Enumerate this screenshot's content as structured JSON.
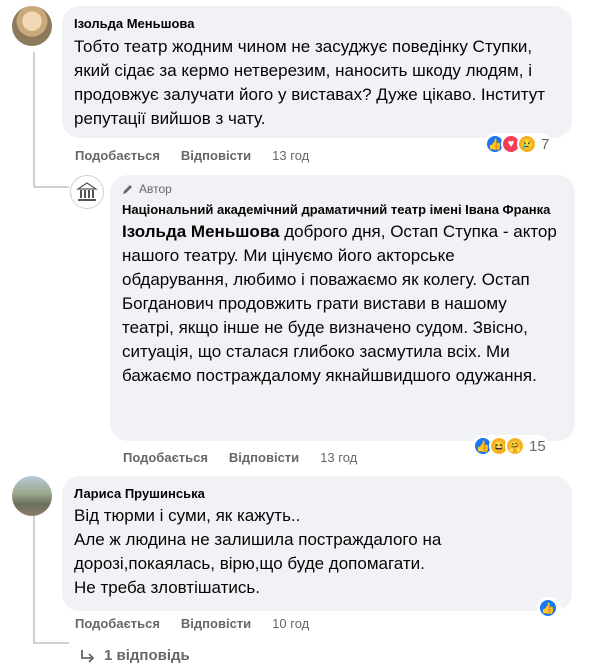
{
  "comments": [
    {
      "author": "Ізольда Меньшова",
      "text": "Тобто театр жодним чином не засуджує поведінку Ступки, який сідає за кермо нетверезим, наносить шкоду людям, і продовжує залучати його у виставах? Дуже цікаво. Інститут репутації вийшов з чату.",
      "like_label": "Подобається",
      "reply_label": "Відповісти",
      "time": "13 год",
      "reaction_count": "7",
      "reaction_icons": [
        "like-icon",
        "love-icon",
        "sad-icon"
      ]
    },
    {
      "badge": "Автор",
      "author": "Національний академічний драматичний театр імені Івана Франка",
      "mention": "Ізольда Меньшова",
      "text": " доброго дня, Остап Ступка - актор нашого театру. Ми цінуємо його акторське обдарування, любимо і поважаємо як колегу. Остап Богданович продовжить грати вистави в нашому театрі, якщо інше не буде визначено судом. Звісно, ситуація, що сталася глибоко засмутила всіх. Ми бажаємо постраждалому якнайшвидшого одужання.",
      "like_label": "Подобається",
      "reply_label": "Відповісти",
      "time": "13 год",
      "reaction_count": "15",
      "reaction_icons": [
        "like-icon",
        "haha-icon",
        "care-icon"
      ]
    },
    {
      "author": "Лариса Прушинська",
      "lines": [
        "Від тюрми і суми, як кажуть..",
        "Але ж людина не залишила постраждалого на дорозі,покаялась, вірю,що буде допомагати.",
        "Не треба зловтішатись."
      ],
      "like_label": "Подобається",
      "reply_label": "Відповісти",
      "time": "10 год",
      "reaction_icons": [
        "like-icon"
      ]
    }
  ],
  "replies_link": "1 відповідь",
  "colors": {
    "bubble": "#f0f2f5",
    "meta": "#65676b",
    "like": "#1877f2",
    "love": "#f33e58",
    "sad": "#f7b125"
  }
}
